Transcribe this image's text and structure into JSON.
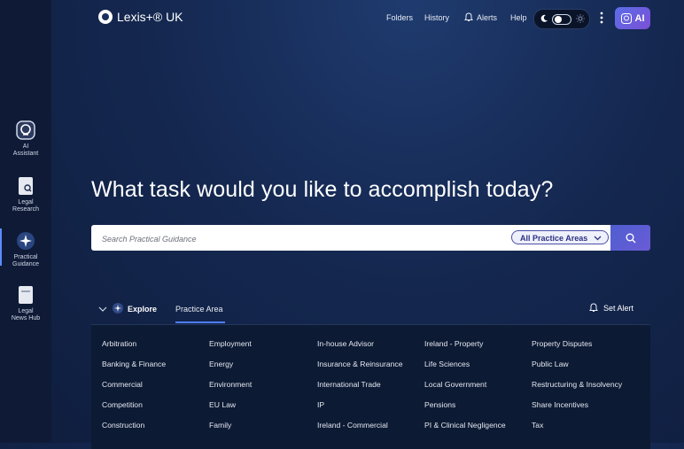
{
  "header": {
    "logo": "Lexis+® UK",
    "nav": [
      "Folders",
      "History",
      "Alerts",
      "Help"
    ],
    "ai_button": "AI"
  },
  "sidebar": {
    "items": [
      {
        "label_line1": "AI",
        "label_line2": "Assistant",
        "icon": "ai-assistant-icon"
      },
      {
        "label_line1": "Legal",
        "label_line2": "Research",
        "icon": "legal-research-icon"
      },
      {
        "label_line1": "Practical",
        "label_line2": "Guidance",
        "icon": "practical-guidance-icon",
        "active": true
      },
      {
        "label_line1": "Legal",
        "label_line2": "News Hub",
        "icon": "news-hub-icon"
      }
    ]
  },
  "main": {
    "headline": "What task would you like to accomplish today?",
    "search_placeholder": "Search Practical Guidance",
    "filter_label": "All Practice Areas"
  },
  "explore": {
    "label": "Explore",
    "tab": "Practice Area",
    "set_alert": "Set Alert"
  },
  "practice_areas": {
    "col1": [
      "Arbitration",
      "Banking & Finance",
      "Commercial",
      "Competition",
      "Construction"
    ],
    "col2": [
      "Employment",
      "Energy",
      "Environment",
      "EU Law",
      "Family"
    ],
    "col3": [
      "In-house Advisor",
      "Insurance & Reinsurance",
      "International Trade",
      "IP",
      "Ireland - Commercial"
    ],
    "col4": [
      "Ireland - Property",
      "Life Sciences",
      "Local Government",
      "Pensions",
      "PI & Clinical Negligence"
    ],
    "col5": [
      "Property Disputes",
      "Public Law",
      "Restructuring & Insolvency",
      "Share Incentives",
      "Tax"
    ]
  },
  "colors": {
    "accent": "#4f7dff",
    "ai_gradient_start": "#5a6ee8",
    "ai_gradient_end": "#7b4fd6"
  }
}
